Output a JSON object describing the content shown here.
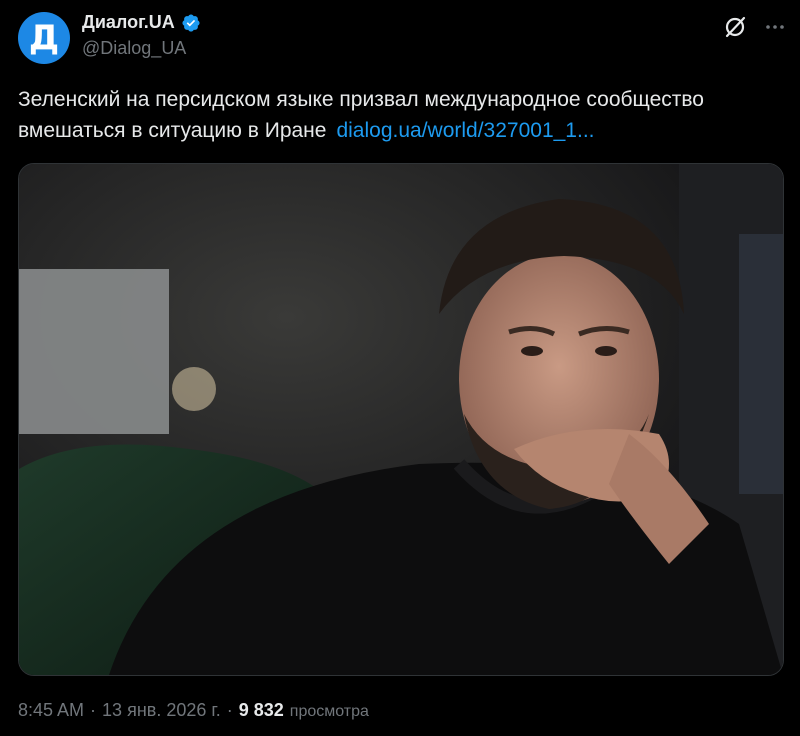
{
  "author": {
    "display_name": "Диалог.UA",
    "handle": "@Dialog_UA",
    "avatar_letter": "Д",
    "avatar_color": "#1d88e5",
    "verified": true,
    "verified_color": "#1d9bf0"
  },
  "tweet": {
    "text": "Зеленский на персидском языке призвал международное сообщество вмешаться в ситуацию в Иране",
    "link_text": "dialog.ua/world/327001_1...",
    "link_color": "#1d9bf0"
  },
  "header_icons": [
    "grok-icon",
    "more-options-icon"
  ],
  "media": {
    "type": "photo"
  },
  "meta": {
    "time": "8:45 AM",
    "separator": "·",
    "date": "13 янв. 2026 г.",
    "views_count": "9 832",
    "views_label": "просмотра"
  }
}
